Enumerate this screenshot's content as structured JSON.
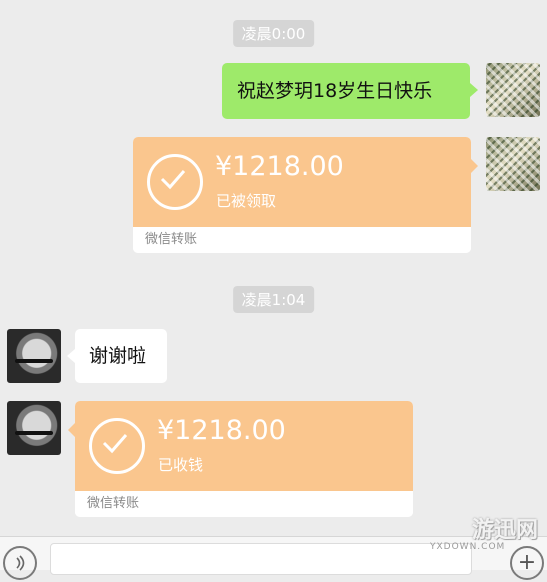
{
  "timestamps": [
    "凌晨0:00",
    "凌晨1:04"
  ],
  "messages": {
    "sent_text": "祝赵梦玥18岁生日快乐",
    "received_text": "谢谢啦"
  },
  "transfers": [
    {
      "amount": "¥1218.00",
      "status": "已被领取",
      "footer": "微信转账"
    },
    {
      "amount": "¥1218.00",
      "status": "已收钱",
      "footer": "微信转账"
    }
  ],
  "input_bar": {
    "voice_icon": "voice-icon",
    "add_icon": "plus-icon"
  },
  "watermark": {
    "text": "游迅网",
    "sub": "YXDOWN.COM"
  },
  "colors": {
    "background": "#ececec",
    "sent_bubble": "#9eea6a",
    "transfer_card": "#fac68e",
    "timestamp_bg": "#d5d5d5"
  }
}
